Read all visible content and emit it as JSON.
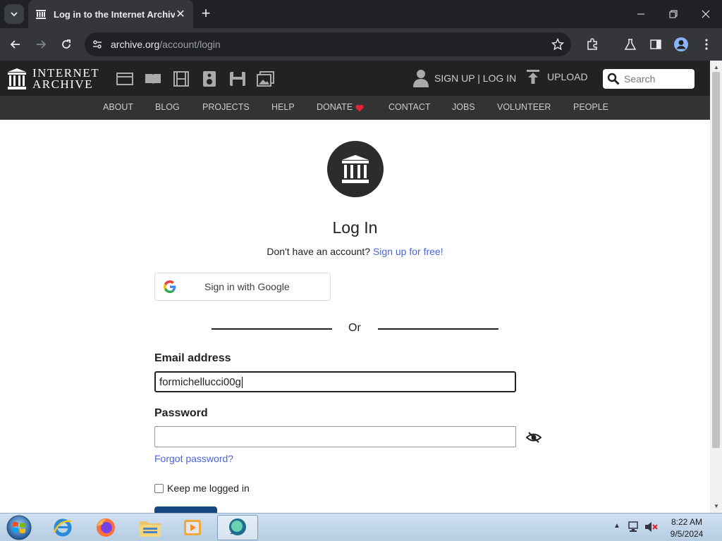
{
  "browser": {
    "tab_title": "Log in to the Internet Archive",
    "url_host": "archive.org",
    "url_path": "/account/login"
  },
  "ia_header": {
    "logo_line1": "INTERNET",
    "logo_line2": "ARCHIVE",
    "signup_login": "SIGN UP | LOG IN",
    "upload": "UPLOAD",
    "search_placeholder": "Search",
    "media_icons": [
      "web-icon",
      "texts-icon",
      "video-icon",
      "audio-icon",
      "software-icon",
      "images-icon"
    ]
  },
  "subnav": [
    "ABOUT",
    "BLOG",
    "PROJECTS",
    "HELP",
    "DONATE",
    "CONTACT",
    "JOBS",
    "VOLUNTEER",
    "PEOPLE"
  ],
  "login": {
    "title": "Log In",
    "no_account_text": "Don't have an account?",
    "signup_link": "Sign up for free!",
    "google_button": "Sign in with Google",
    "or_text": "Or",
    "email_label": "Email address",
    "email_value": "formichellucci00g",
    "password_label": "Password",
    "forgot_password": "Forgot password?",
    "keep_logged_in": "Keep me logged in"
  },
  "taskbar": {
    "time": "8:22 AM",
    "date": "9/5/2024"
  },
  "colors": {
    "ia_dark": "#222222",
    "ia_subnav": "#333333",
    "link_blue": "#4b64d8",
    "donate_heart": "#e32636",
    "submit_button": "#194880"
  }
}
